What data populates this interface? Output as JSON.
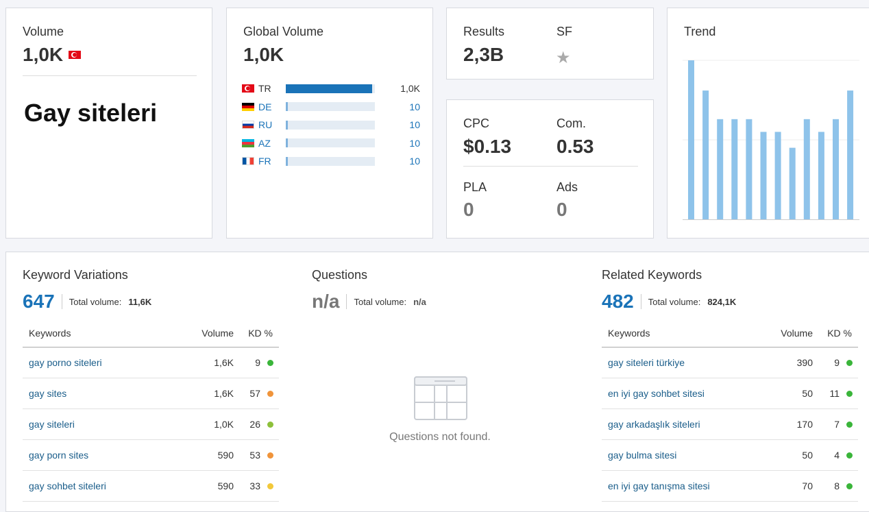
{
  "volume": {
    "label": "Volume",
    "value": "1,0K",
    "country_flag": "tr",
    "keyword": "Gay siteleri"
  },
  "global_volume": {
    "label": "Global Volume",
    "value": "1,0K",
    "countries": [
      {
        "code": "TR",
        "flag": "tr",
        "value": "1,0K",
        "share": 0.97
      },
      {
        "code": "DE",
        "flag": "de",
        "value": "10",
        "share": 0.02
      },
      {
        "code": "RU",
        "flag": "ru",
        "value": "10",
        "share": 0.02
      },
      {
        "code": "AZ",
        "flag": "az",
        "value": "10",
        "share": 0.02
      },
      {
        "code": "FR",
        "flag": "fr",
        "value": "10",
        "share": 0.02
      }
    ]
  },
  "results": {
    "label": "Results",
    "value": "2,3B",
    "sf_label": "SF",
    "sf_icon": "star-icon"
  },
  "cpc": {
    "cpc_label": "CPC",
    "cpc_value": "$0.13",
    "com_label": "Com.",
    "com_value": "0.53",
    "pla_label": "PLA",
    "pla_value": "0",
    "ads_label": "Ads",
    "ads_value": "0"
  },
  "trend": {
    "label": "Trend"
  },
  "chart_data": {
    "type": "bar",
    "title": "Trend",
    "values": [
      1.0,
      0.81,
      0.63,
      0.63,
      0.63,
      0.55,
      0.55,
      0.45,
      0.63,
      0.55,
      0.63,
      0.81
    ],
    "ylim": [
      0,
      1
    ],
    "color": "#8ec3ea",
    "grid": true
  },
  "keyword_variations": {
    "title": "Keyword Variations",
    "count": "647",
    "total_label": "Total volume:",
    "total_value": "11,6K",
    "headers": {
      "keywords": "Keywords",
      "volume": "Volume",
      "kd": "KD %"
    },
    "rows": [
      {
        "keyword": "gay porno siteleri",
        "volume": "1,6K",
        "kd": "9",
        "kd_color": "#3ab53a"
      },
      {
        "keyword": "gay sites",
        "volume": "1,6K",
        "kd": "57",
        "kd_color": "#f0943a"
      },
      {
        "keyword": "gay siteleri",
        "volume": "1,0K",
        "kd": "26",
        "kd_color": "#8dc03b"
      },
      {
        "keyword": "gay porn sites",
        "volume": "590",
        "kd": "53",
        "kd_color": "#f0943a"
      },
      {
        "keyword": "gay sohbet siteleri",
        "volume": "590",
        "kd": "33",
        "kd_color": "#f2c83a"
      }
    ]
  },
  "questions": {
    "title": "Questions",
    "count": "n/a",
    "total_label": "Total volume:",
    "total_value": "n/a",
    "empty_icon": "empty-table-icon",
    "empty_text": "Questions not found."
  },
  "related_keywords": {
    "title": "Related Keywords",
    "count": "482",
    "total_label": "Total volume:",
    "total_value": "824,1K",
    "headers": {
      "keywords": "Keywords",
      "volume": "Volume",
      "kd": "KD %"
    },
    "rows": [
      {
        "keyword": "gay siteleri türkiye",
        "volume": "390",
        "kd": "9",
        "kd_color": "#3ab53a"
      },
      {
        "keyword": "en iyi gay sohbet sitesi",
        "volume": "50",
        "kd": "11",
        "kd_color": "#3ab53a"
      },
      {
        "keyword": "gay arkadaşlık siteleri",
        "volume": "170",
        "kd": "7",
        "kd_color": "#3ab53a"
      },
      {
        "keyword": "gay bulma sitesi",
        "volume": "50",
        "kd": "4",
        "kd_color": "#3ab53a"
      },
      {
        "keyword": "en iyi gay tanışma sitesi",
        "volume": "70",
        "kd": "8",
        "kd_color": "#3ab53a"
      }
    ]
  }
}
